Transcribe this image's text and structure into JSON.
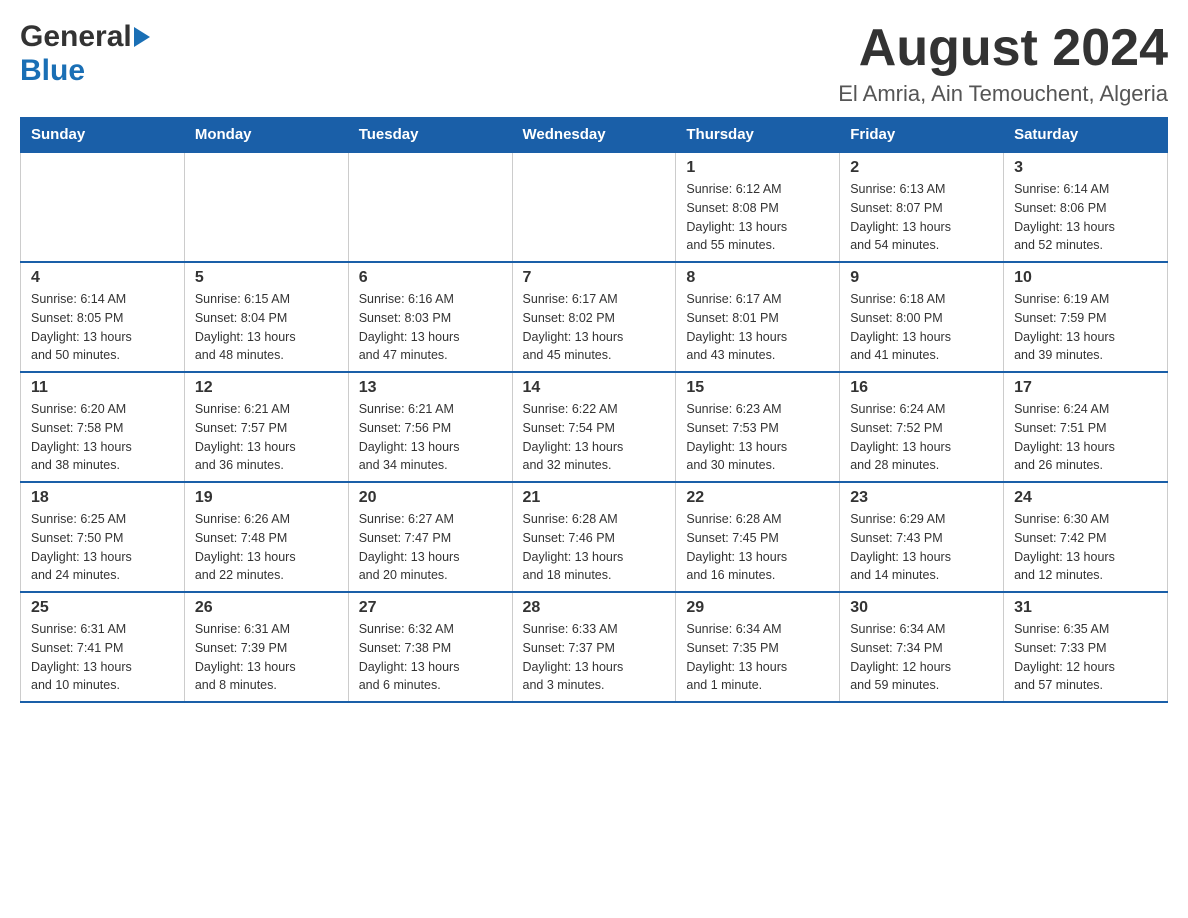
{
  "header": {
    "logo_general": "General",
    "logo_blue": "Blue",
    "month_title": "August 2024",
    "location": "El Amria, Ain Temouchent, Algeria"
  },
  "days_of_week": [
    "Sunday",
    "Monday",
    "Tuesday",
    "Wednesday",
    "Thursday",
    "Friday",
    "Saturday"
  ],
  "weeks": [
    [
      {
        "day": "",
        "info": ""
      },
      {
        "day": "",
        "info": ""
      },
      {
        "day": "",
        "info": ""
      },
      {
        "day": "",
        "info": ""
      },
      {
        "day": "1",
        "info": "Sunrise: 6:12 AM\nSunset: 8:08 PM\nDaylight: 13 hours\nand 55 minutes."
      },
      {
        "day": "2",
        "info": "Sunrise: 6:13 AM\nSunset: 8:07 PM\nDaylight: 13 hours\nand 54 minutes."
      },
      {
        "day": "3",
        "info": "Sunrise: 6:14 AM\nSunset: 8:06 PM\nDaylight: 13 hours\nand 52 minutes."
      }
    ],
    [
      {
        "day": "4",
        "info": "Sunrise: 6:14 AM\nSunset: 8:05 PM\nDaylight: 13 hours\nand 50 minutes."
      },
      {
        "day": "5",
        "info": "Sunrise: 6:15 AM\nSunset: 8:04 PM\nDaylight: 13 hours\nand 48 minutes."
      },
      {
        "day": "6",
        "info": "Sunrise: 6:16 AM\nSunset: 8:03 PM\nDaylight: 13 hours\nand 47 minutes."
      },
      {
        "day": "7",
        "info": "Sunrise: 6:17 AM\nSunset: 8:02 PM\nDaylight: 13 hours\nand 45 minutes."
      },
      {
        "day": "8",
        "info": "Sunrise: 6:17 AM\nSunset: 8:01 PM\nDaylight: 13 hours\nand 43 minutes."
      },
      {
        "day": "9",
        "info": "Sunrise: 6:18 AM\nSunset: 8:00 PM\nDaylight: 13 hours\nand 41 minutes."
      },
      {
        "day": "10",
        "info": "Sunrise: 6:19 AM\nSunset: 7:59 PM\nDaylight: 13 hours\nand 39 minutes."
      }
    ],
    [
      {
        "day": "11",
        "info": "Sunrise: 6:20 AM\nSunset: 7:58 PM\nDaylight: 13 hours\nand 38 minutes."
      },
      {
        "day": "12",
        "info": "Sunrise: 6:21 AM\nSunset: 7:57 PM\nDaylight: 13 hours\nand 36 minutes."
      },
      {
        "day": "13",
        "info": "Sunrise: 6:21 AM\nSunset: 7:56 PM\nDaylight: 13 hours\nand 34 minutes."
      },
      {
        "day": "14",
        "info": "Sunrise: 6:22 AM\nSunset: 7:54 PM\nDaylight: 13 hours\nand 32 minutes."
      },
      {
        "day": "15",
        "info": "Sunrise: 6:23 AM\nSunset: 7:53 PM\nDaylight: 13 hours\nand 30 minutes."
      },
      {
        "day": "16",
        "info": "Sunrise: 6:24 AM\nSunset: 7:52 PM\nDaylight: 13 hours\nand 28 minutes."
      },
      {
        "day": "17",
        "info": "Sunrise: 6:24 AM\nSunset: 7:51 PM\nDaylight: 13 hours\nand 26 minutes."
      }
    ],
    [
      {
        "day": "18",
        "info": "Sunrise: 6:25 AM\nSunset: 7:50 PM\nDaylight: 13 hours\nand 24 minutes."
      },
      {
        "day": "19",
        "info": "Sunrise: 6:26 AM\nSunset: 7:48 PM\nDaylight: 13 hours\nand 22 minutes."
      },
      {
        "day": "20",
        "info": "Sunrise: 6:27 AM\nSunset: 7:47 PM\nDaylight: 13 hours\nand 20 minutes."
      },
      {
        "day": "21",
        "info": "Sunrise: 6:28 AM\nSunset: 7:46 PM\nDaylight: 13 hours\nand 18 minutes."
      },
      {
        "day": "22",
        "info": "Sunrise: 6:28 AM\nSunset: 7:45 PM\nDaylight: 13 hours\nand 16 minutes."
      },
      {
        "day": "23",
        "info": "Sunrise: 6:29 AM\nSunset: 7:43 PM\nDaylight: 13 hours\nand 14 minutes."
      },
      {
        "day": "24",
        "info": "Sunrise: 6:30 AM\nSunset: 7:42 PM\nDaylight: 13 hours\nand 12 minutes."
      }
    ],
    [
      {
        "day": "25",
        "info": "Sunrise: 6:31 AM\nSunset: 7:41 PM\nDaylight: 13 hours\nand 10 minutes."
      },
      {
        "day": "26",
        "info": "Sunrise: 6:31 AM\nSunset: 7:39 PM\nDaylight: 13 hours\nand 8 minutes."
      },
      {
        "day": "27",
        "info": "Sunrise: 6:32 AM\nSunset: 7:38 PM\nDaylight: 13 hours\nand 6 minutes."
      },
      {
        "day": "28",
        "info": "Sunrise: 6:33 AM\nSunset: 7:37 PM\nDaylight: 13 hours\nand 3 minutes."
      },
      {
        "day": "29",
        "info": "Sunrise: 6:34 AM\nSunset: 7:35 PM\nDaylight: 13 hours\nand 1 minute."
      },
      {
        "day": "30",
        "info": "Sunrise: 6:34 AM\nSunset: 7:34 PM\nDaylight: 12 hours\nand 59 minutes."
      },
      {
        "day": "31",
        "info": "Sunrise: 6:35 AM\nSunset: 7:33 PM\nDaylight: 12 hours\nand 57 minutes."
      }
    ]
  ]
}
